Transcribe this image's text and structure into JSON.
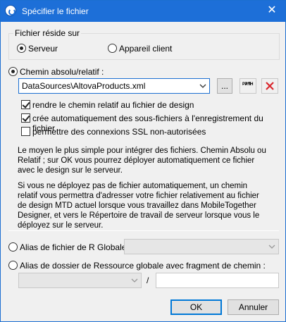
{
  "window": {
    "title": "Spécifier le fichier",
    "close_glyph": "✕"
  },
  "location_group": {
    "legend": "Fichier réside sur",
    "server_label": "Serveur",
    "client_label": "Appareil client",
    "selected": "server"
  },
  "path_section": {
    "radio_label": "Chemin absolu/relatif :",
    "path_value": "DataSources\\AltovaProducts.xml",
    "browse_label": "...",
    "path_button_label": "PATH",
    "options": [
      {
        "label": "rendre le chemin relatif au fichier de design",
        "checked": true
      },
      {
        "label": "crée automatiquement des sous-fichiers à l'enregistrement du fichier",
        "checked": true
      },
      {
        "label": "permettre des connexions SSL non-autorisées",
        "checked": false
      }
    ],
    "info_1": "Le moyen le plus simple pour intégrer des fichiers. Chemin Absolu ou Relatif ; sur OK vous pourrez déployer automatiquement ce fichier avec le design sur le serveur.",
    "info_2": "Si vous ne déployez pas de fichier automatiquement, un chemin relatif vous permettra d'adresser votre fichier relativement au fichier de design MTD actuel lorsque vous travaillez dans MobileTogether Designer, et vers le Répertoire de travail de serveur lorsque vous le déployez sur le serveur."
  },
  "global_alias": {
    "file_alias_label": "Alias de fichier de R Globale :",
    "folder_alias_label": "Alias de dossier de Ressource globale avec fragment de chemin :",
    "path_separator": "/"
  },
  "buttons": {
    "ok": "OK",
    "cancel": "Annuler"
  },
  "icons": {
    "app": "altova-app-icon",
    "close": "close-icon",
    "delete": "delete-x-icon",
    "dropdown": "chevron-down-icon"
  },
  "colors": {
    "titlebar": "#1d6fd8",
    "delete_red": "#d9262c",
    "dialog_bg": "#f0f0f0"
  }
}
